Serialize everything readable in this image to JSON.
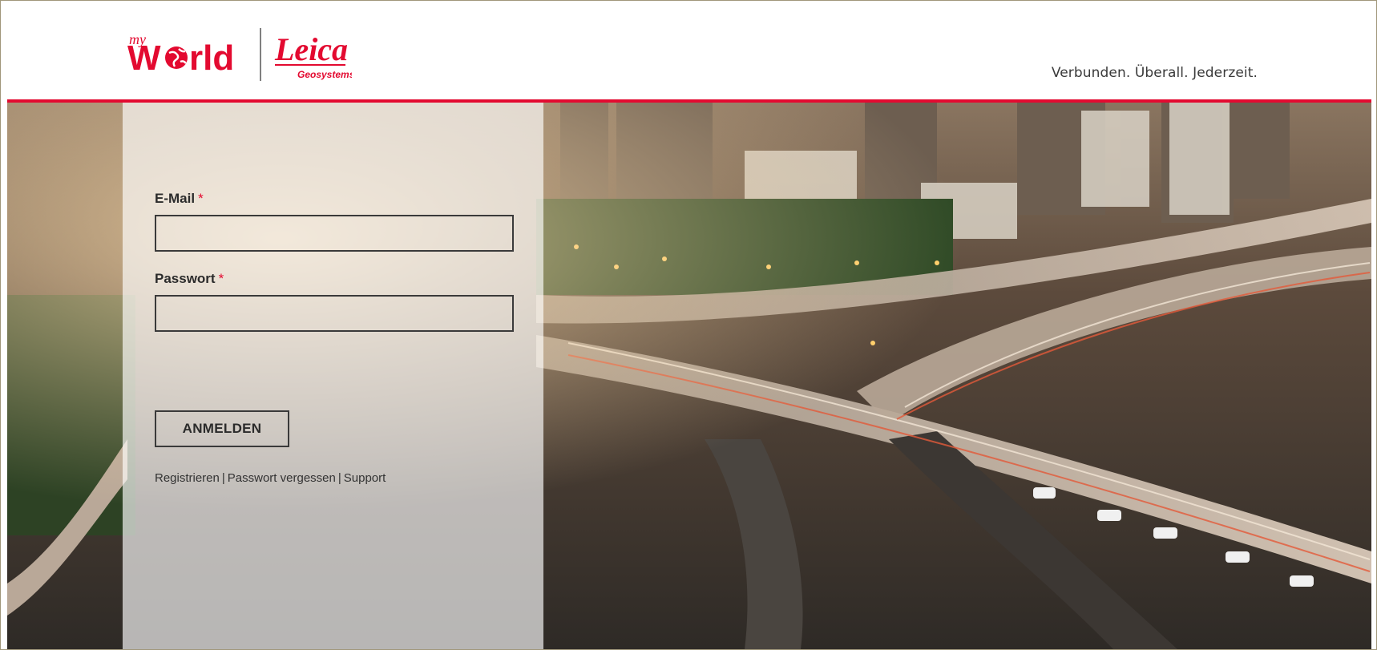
{
  "header": {
    "logo_my": "my",
    "logo_world": "world",
    "brand_name": "Leica",
    "brand_sub": "Geosystems",
    "tagline": "Verbunden. Überall. Jederzeit.",
    "accent_color": "#e30a30"
  },
  "form": {
    "email_label": "E-Mail",
    "password_label": "Passwort",
    "required_marker": "*",
    "email_value": "",
    "password_value": "",
    "login_button": "ANMELDEN",
    "links": {
      "register": "Registrieren",
      "forgot_password": "Passwort vergessen",
      "support": "Support",
      "separator": "|"
    }
  },
  "icons": {
    "globe": "globe-icon"
  }
}
